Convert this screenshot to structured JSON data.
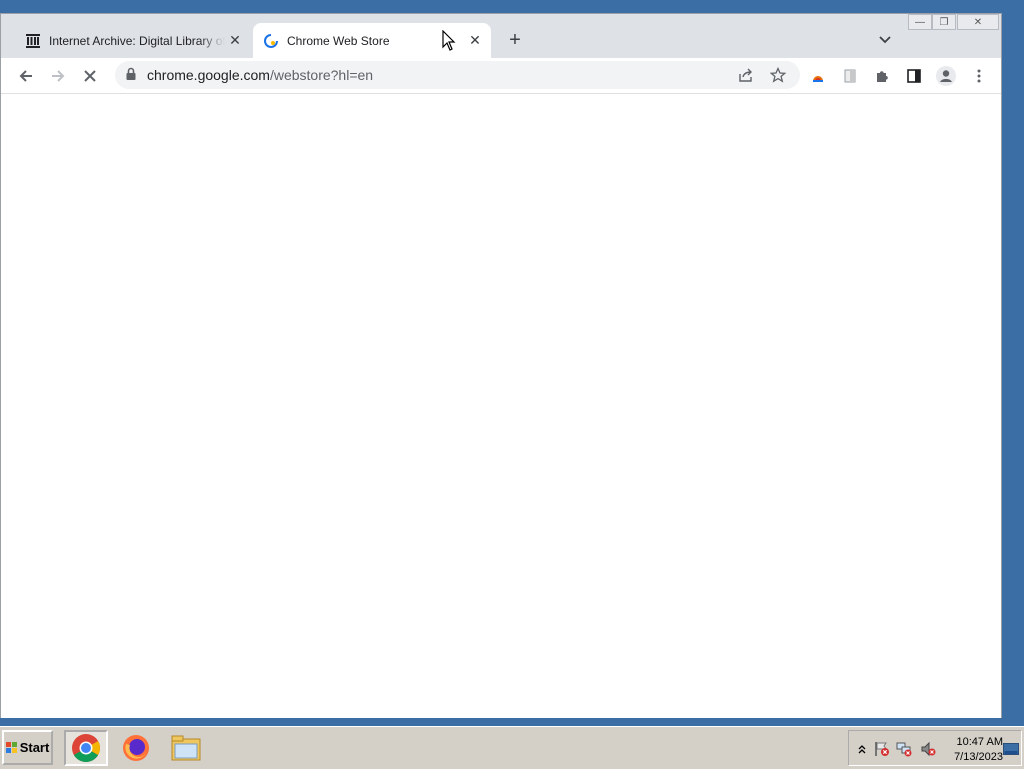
{
  "tabs": [
    {
      "title": "Internet Archive: Digital Library of Free & Borrowable Books",
      "icon": "internet-archive-icon",
      "active": false
    },
    {
      "title": "Chrome Web Store",
      "icon": "chrome-web-store-icon",
      "active": true
    }
  ],
  "address_bar": {
    "url_host": "chrome.google.com",
    "url_rest": "/webstore?hl=en"
  },
  "taskbar": {
    "start_label": "Start",
    "apps": [
      "chrome-icon",
      "firefox-icon",
      "file-explorer-icon"
    ],
    "clock_time": "10:47 AM",
    "clock_date": "7/13/2023"
  },
  "colors": {
    "desktop": "#3a6ea5",
    "tabstrip": "#dee1e6",
    "toolbar": "#ffffff",
    "taskbar": "#d4d0c8"
  }
}
